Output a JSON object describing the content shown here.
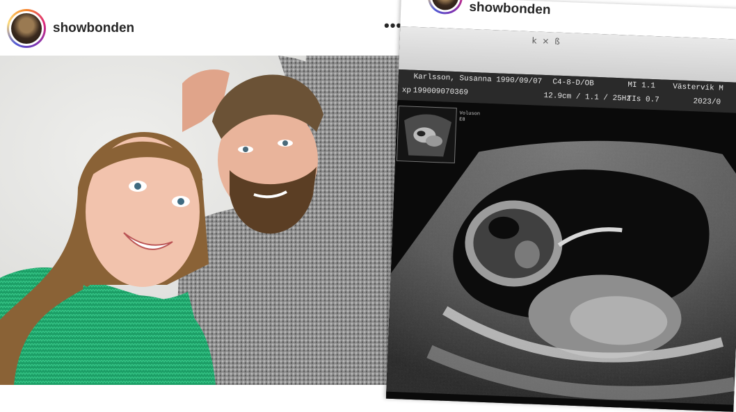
{
  "left_post": {
    "username": "showbonden",
    "more_label": "•••",
    "photo_alt": "photo"
  },
  "right_post": {
    "username": "showbonden",
    "paper_marks": "k  ×  ß",
    "ultrasound": {
      "patient": "Karlsson, Susanna  1990/09/07",
      "patient_id": "199009070369",
      "probe": "C4-8-D/OB",
      "depth": "12.9cm / 1.1 / 25Hz",
      "mi": "MI  1.1",
      "tis": "TIs  0.7",
      "location": "Västervik M",
      "date": "2023/0",
      "side_label": "xp",
      "thumb_label_1": "Voluson",
      "thumb_label_2": "E8"
    }
  },
  "colors": {
    "username": "#262626",
    "sweater_green": "#1fa86e",
    "sweater_grey": "#8a8a8a",
    "wall": "#e6e6e4",
    "scan_bg": "#0a0a0a"
  },
  "icons": [
    "more-horizontal-icon"
  ]
}
